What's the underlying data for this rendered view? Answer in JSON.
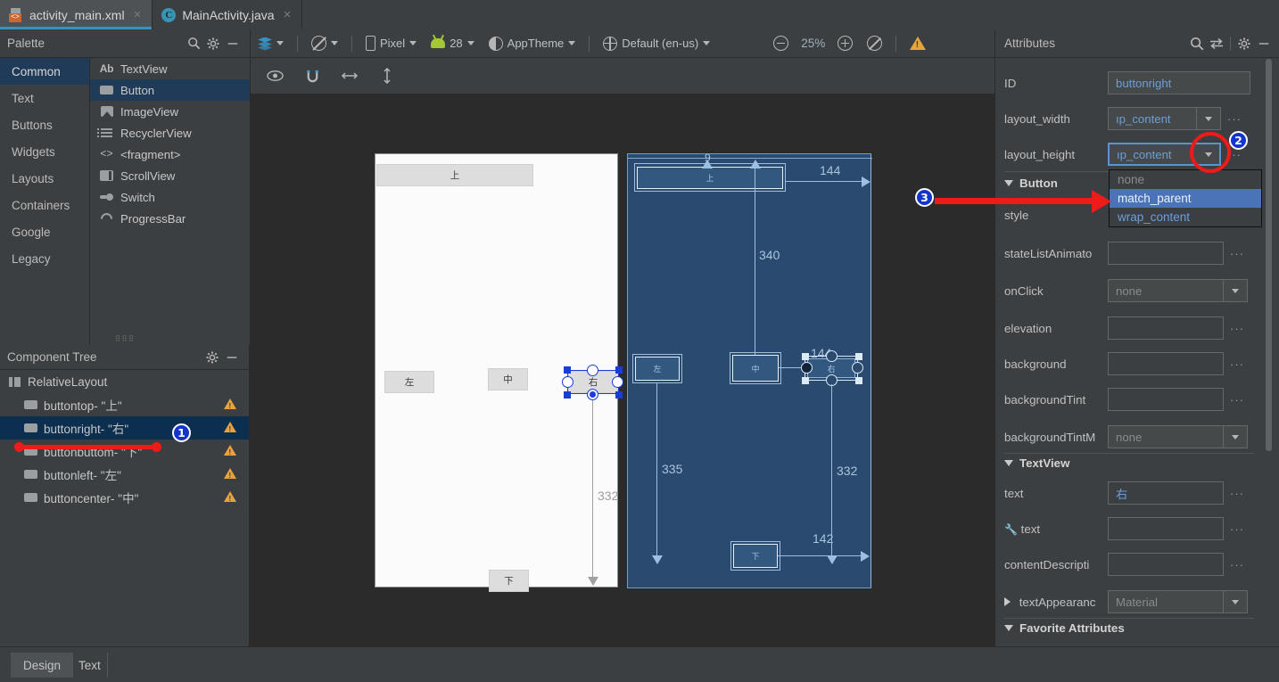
{
  "window": {
    "tabs": [
      {
        "label": "activity_main.xml",
        "icon": "xml-file-icon",
        "active": true,
        "close": "×"
      },
      {
        "label": "MainActivity.java",
        "icon": "java-class-icon",
        "active": false,
        "close": "×"
      }
    ]
  },
  "palette": {
    "title": "Palette",
    "header_icons": [
      "search-icon",
      "gear-icon",
      "minimize-icon"
    ],
    "categories": [
      {
        "label": "Common",
        "selected": true
      },
      {
        "label": "Text",
        "selected": false
      },
      {
        "label": "Buttons",
        "selected": false
      },
      {
        "label": "Widgets",
        "selected": false
      },
      {
        "label": "Layouts",
        "selected": false
      },
      {
        "label": "Containers",
        "selected": false
      },
      {
        "label": "Google",
        "selected": false
      },
      {
        "label": "Legacy",
        "selected": false
      }
    ],
    "items": [
      {
        "label": "TextView",
        "icon": "ab-text-icon",
        "selected": false
      },
      {
        "label": "Button",
        "icon": "button-icon",
        "selected": true
      },
      {
        "label": "ImageView",
        "icon": "image-icon",
        "selected": false
      },
      {
        "label": "RecyclerView",
        "icon": "list-icon",
        "selected": false
      },
      {
        "label": "<fragment>",
        "icon": "code-brackets-icon",
        "selected": false
      },
      {
        "label": "ScrollView",
        "icon": "scroll-icon",
        "selected": false
      },
      {
        "label": "Switch",
        "icon": "switch-icon",
        "selected": false
      },
      {
        "label": "ProgressBar",
        "icon": "spinner-icon",
        "selected": false
      }
    ],
    "ab_glyph": "Ab"
  },
  "toolbar": {
    "design_mode": {
      "label": "",
      "icon": "layers-icon"
    },
    "orientation": {
      "label": "",
      "icon": "rotate-icon"
    },
    "device": {
      "label": "Pixel",
      "icon": "phone-icon"
    },
    "api": {
      "label": "28",
      "icon": "android-icon"
    },
    "theme": {
      "label": "AppTheme",
      "icon": "theme-icon"
    },
    "locale": {
      "label": "Default (en-us)",
      "icon": "globe-icon"
    },
    "zoom_out": "zoom-out-icon",
    "zoom_level": "25%",
    "zoom_in": "zoom-in-icon",
    "zoom_fit": "zoom-reset-icon",
    "warning": "warning-icon"
  },
  "canvas_toolbar": {
    "icons": [
      "eye-icon",
      "magnet-icon",
      "horizontal-align-icon",
      "vertical-align-icon"
    ]
  },
  "component_tree": {
    "title": "Component Tree",
    "header_icons": [
      "gear-icon",
      "minimize-icon"
    ],
    "nodes": [
      {
        "label": "RelativeLayout",
        "depth": 0,
        "icon": "relative-layout-icon",
        "selected": false,
        "warning": false
      },
      {
        "label": "buttontop- \"上\"",
        "depth": 1,
        "icon": "button-icon",
        "selected": false,
        "warning": true
      },
      {
        "label": "buttonright- \"右\"",
        "depth": 1,
        "icon": "button-icon",
        "selected": true,
        "warning": true
      },
      {
        "label": "buttonbuttom- \"下\"",
        "depth": 1,
        "icon": "button-icon",
        "selected": false,
        "warning": true
      },
      {
        "label": "buttonleft- \"左\"",
        "depth": 1,
        "icon": "button-icon",
        "selected": false,
        "warning": true
      },
      {
        "label": "buttoncenter- \"中\"",
        "depth": 1,
        "icon": "button-icon",
        "selected": false,
        "warning": true
      }
    ]
  },
  "design_surface": {
    "preview_buttons": [
      {
        "id": "pb-top",
        "label": "上"
      },
      {
        "id": "pb-left",
        "label": "左"
      },
      {
        "id": "pb-center",
        "label": "中"
      },
      {
        "id": "pb-right",
        "label": "右",
        "selected": true
      },
      {
        "id": "pb-bottom",
        "label": "下"
      }
    ],
    "preview_distance_label": "332",
    "blueprint_buttons": [
      {
        "id": "bp-top",
        "label": "上"
      },
      {
        "id": "bp-left",
        "label": "左"
      },
      {
        "id": "bp-center",
        "label": "中"
      },
      {
        "id": "bp-right",
        "label": "右",
        "selected": true
      },
      {
        "id": "bp-bottom",
        "label": "下"
      }
    ],
    "blueprint_dimensions": {
      "top_small": "9",
      "top_right": "144",
      "center_vertical": "340",
      "right_width": "144",
      "left_vertical": "335",
      "right_vertical": "332",
      "bottom_right": "142"
    }
  },
  "attributes": {
    "title": "Attributes",
    "header_icons": [
      "search-icon",
      "swap-icon",
      "gear-icon",
      "minimize-icon"
    ],
    "rows": [
      {
        "name": "ID",
        "value": "buttonright",
        "kind": "text"
      },
      {
        "name": "layout_width",
        "value": "ıp_content",
        "kind": "combo"
      },
      {
        "name": "layout_height",
        "value": "ıp_content",
        "kind": "combo",
        "focused": true
      }
    ],
    "section_button": "Button",
    "button_rows": [
      {
        "name": "style",
        "value": "",
        "kind": "hidden"
      },
      {
        "name": "stateListAnimato",
        "value": "",
        "kind": "text"
      },
      {
        "name": "onClick",
        "value": "none",
        "kind": "combo",
        "muted": true
      },
      {
        "name": "elevation",
        "value": "",
        "kind": "text"
      },
      {
        "name": "background",
        "value": "",
        "kind": "text"
      },
      {
        "name": "backgroundTint",
        "value": "",
        "kind": "text"
      },
      {
        "name": "backgroundTintM",
        "value": "none",
        "kind": "combo",
        "muted": true
      }
    ],
    "section_textview": "TextView",
    "textview_rows": [
      {
        "name": "text",
        "value": "右",
        "kind": "text"
      },
      {
        "name": "text",
        "value": "",
        "kind": "text",
        "wrench": true
      },
      {
        "name": "contentDescripti",
        "value": "",
        "kind": "text"
      },
      {
        "name": "textAppearanc",
        "value": "Material",
        "kind": "combo",
        "muted": true,
        "expandable": true
      }
    ],
    "section_favorites": "Favorite Attributes"
  },
  "dropdown": {
    "options": [
      {
        "label": "none",
        "state": "muted"
      },
      {
        "label": "match_parent",
        "state": "selected"
      },
      {
        "label": "wrap_content",
        "state": "normal"
      }
    ]
  },
  "annotations": {
    "badge1": "1",
    "badge2": "2",
    "badge3": "3"
  },
  "bottom_tabs": [
    {
      "label": "Design",
      "active": true
    },
    {
      "label": "Text",
      "active": false
    }
  ],
  "colors": {
    "background": "#3c3f41",
    "canvas": "#2b2b2b",
    "accent_blue": "#3592c4",
    "selection_blue": "#1f3b57",
    "annotation_red": "#ee1b1b",
    "badge_blue": "#1435cc",
    "warning_amber": "#e8a33d",
    "blueprint_bg": "#2b4a6f",
    "dropdown_highlight": "#4b74b8",
    "value_blue": "#6c9fd8"
  }
}
